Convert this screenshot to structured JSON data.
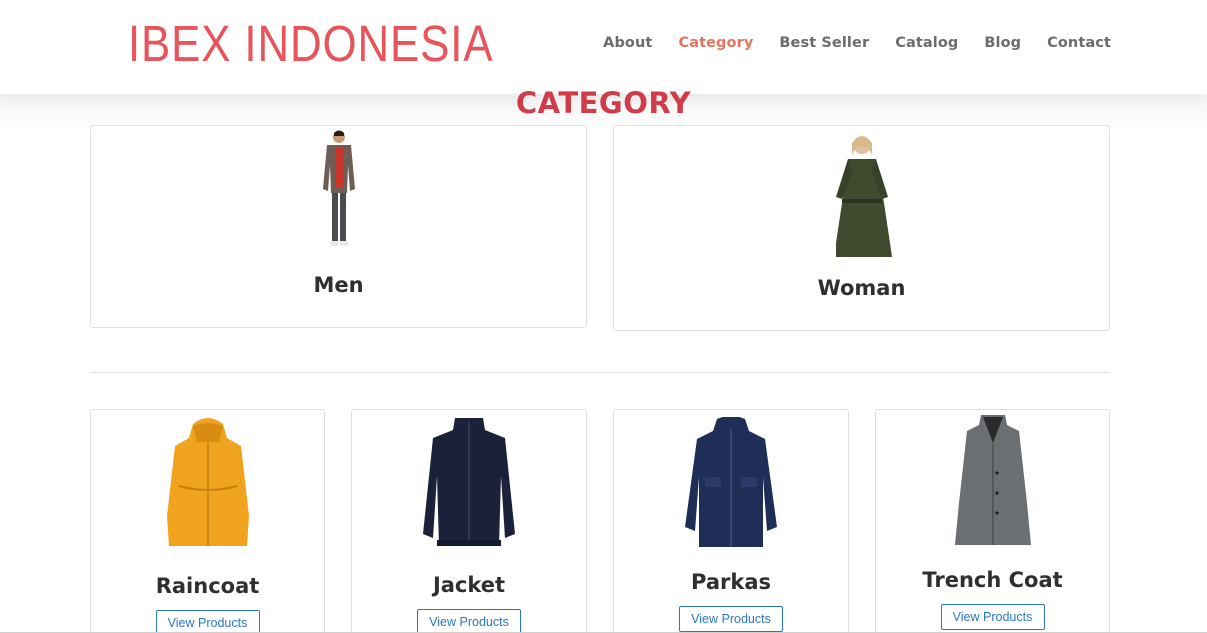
{
  "brand": {
    "logo_text": "IBEX INDONESIA",
    "accent": "#e8545c",
    "title_color": "#d13c4b"
  },
  "nav": {
    "items": [
      {
        "label": "About"
      },
      {
        "label": "Category"
      },
      {
        "label": "Best Seller"
      },
      {
        "label": "Catalog"
      },
      {
        "label": "Blog"
      },
      {
        "label": "Contact"
      }
    ]
  },
  "section": {
    "title": "CATEGORY"
  },
  "gender_cards": [
    {
      "label": "Men"
    },
    {
      "label": "Woman"
    }
  ],
  "product_cards": [
    {
      "label": "Raincoat",
      "button": "View Products",
      "color": "#f0a31f"
    },
    {
      "label": "Jacket",
      "button": "View Products",
      "color": "#1b2138"
    },
    {
      "label": "Parkas",
      "button": "View Products",
      "color": "#1f2e57"
    },
    {
      "label": "Trench Coat",
      "button": "View Products",
      "color": "#6b6e72"
    }
  ]
}
